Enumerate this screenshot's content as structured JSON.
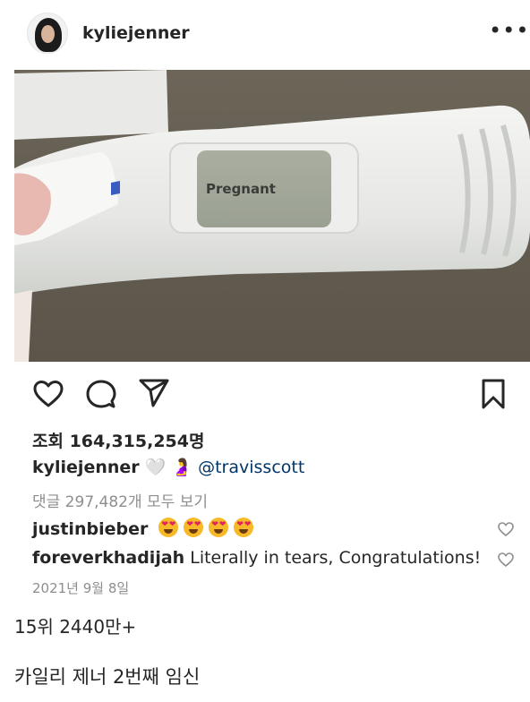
{
  "header": {
    "username": "kyliejenner",
    "more_label": "•••"
  },
  "media": {
    "test_display_text": "Pregnant",
    "muted": true
  },
  "stats": {
    "views_text": "조회 164,315,254명"
  },
  "caption": {
    "username": "kyliejenner",
    "emojis": "🤍 🤰",
    "mention": "@travisscott"
  },
  "view_all_comments": "댓글 297,482개 모두 보기",
  "comments": [
    {
      "username": "justinbieber",
      "text": ""
    },
    {
      "username": "foreverkhadijah",
      "text": "Literally in tears, Congratulations!"
    }
  ],
  "date": "2021년 9월 8일",
  "overlay": {
    "rank_text": "15위 2440만+",
    "title_text": "카일리 제너 2번째 임신"
  }
}
